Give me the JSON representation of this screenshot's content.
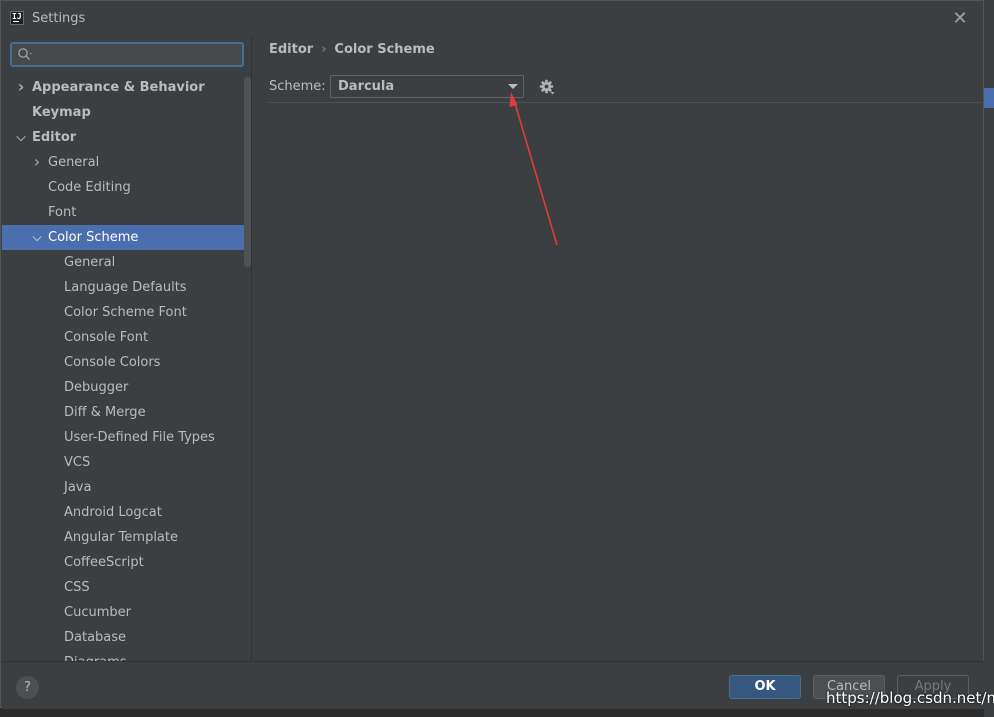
{
  "window": {
    "title": "Settings"
  },
  "search": {
    "placeholder": "",
    "value": ""
  },
  "sidebar": {
    "items": [
      {
        "label": "Appearance & Behavior",
        "level": 0,
        "expandable": true,
        "expanded": false,
        "bold": true
      },
      {
        "label": "Keymap",
        "level": 0,
        "expandable": false,
        "bold": true
      },
      {
        "label": "Editor",
        "level": 0,
        "expandable": true,
        "expanded": true,
        "bold": true
      },
      {
        "label": "General",
        "level": 1,
        "expandable": true,
        "expanded": false
      },
      {
        "label": "Code Editing",
        "level": 1,
        "expandable": false
      },
      {
        "label": "Font",
        "level": 1,
        "expandable": false
      },
      {
        "label": "Color Scheme",
        "level": 1,
        "expandable": true,
        "expanded": true,
        "selected": true
      },
      {
        "label": "General",
        "level": 2,
        "expandable": false
      },
      {
        "label": "Language Defaults",
        "level": 2,
        "expandable": false
      },
      {
        "label": "Color Scheme Font",
        "level": 2,
        "expandable": false
      },
      {
        "label": "Console Font",
        "level": 2,
        "expandable": false
      },
      {
        "label": "Console Colors",
        "level": 2,
        "expandable": false
      },
      {
        "label": "Debugger",
        "level": 2,
        "expandable": false
      },
      {
        "label": "Diff & Merge",
        "level": 2,
        "expandable": false
      },
      {
        "label": "User-Defined File Types",
        "level": 2,
        "expandable": false
      },
      {
        "label": "VCS",
        "level": 2,
        "expandable": false
      },
      {
        "label": "Java",
        "level": 2,
        "expandable": false
      },
      {
        "label": "Android Logcat",
        "level": 2,
        "expandable": false
      },
      {
        "label": "Angular Template",
        "level": 2,
        "expandable": false
      },
      {
        "label": "CoffeeScript",
        "level": 2,
        "expandable": false
      },
      {
        "label": "CSS",
        "level": 2,
        "expandable": false
      },
      {
        "label": "Cucumber",
        "level": 2,
        "expandable": false
      },
      {
        "label": "Database",
        "level": 2,
        "expandable": false
      },
      {
        "label": "Diagrams",
        "level": 2,
        "expandable": false
      }
    ]
  },
  "breadcrumb": {
    "parent": "Editor",
    "separator": "›",
    "current": "Color Scheme"
  },
  "scheme": {
    "label": "Scheme:",
    "value": "Darcula"
  },
  "footer": {
    "help": "?",
    "ok": "OK",
    "cancel": "Cancel",
    "apply": "Apply"
  },
  "watermark": "https://blog.csdn.net/m",
  "colors": {
    "selection": "#4b6eaf",
    "ok_button": "#365880",
    "annotation_arrow": "#e03a3a"
  },
  "icons": [
    "app-icon",
    "close-icon",
    "search-icon",
    "chevron-right-icon",
    "chevron-down-icon",
    "dropdown-arrow-icon",
    "gear-icon",
    "help-icon"
  ]
}
